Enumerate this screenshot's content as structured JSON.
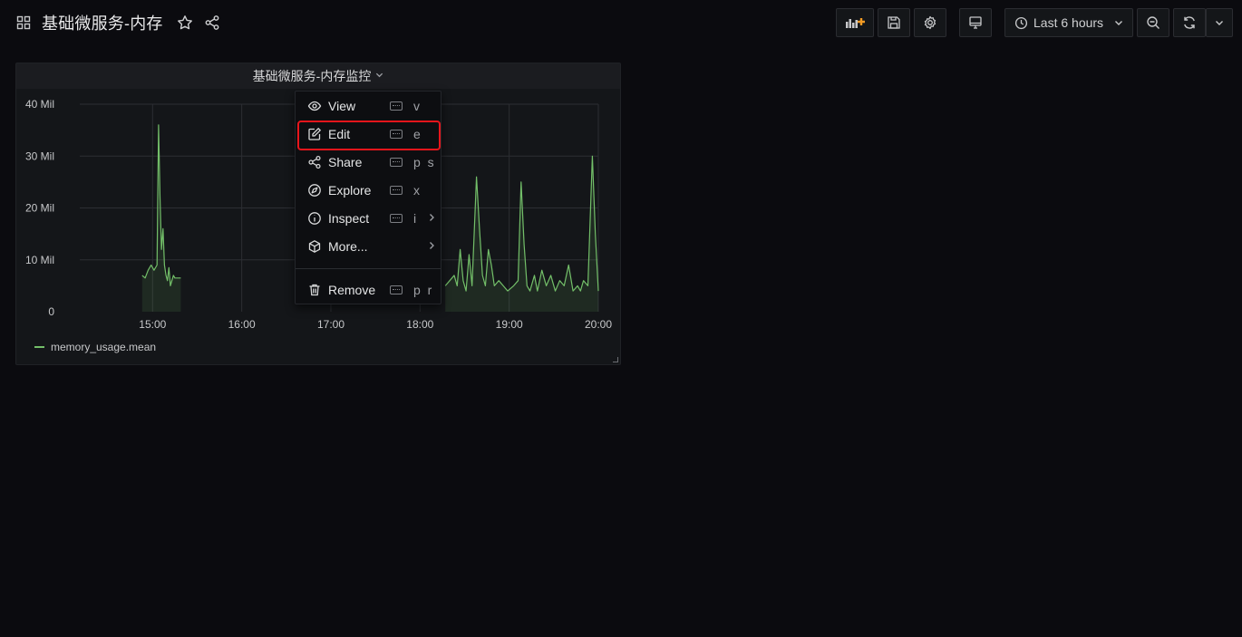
{
  "dashboard": {
    "title": "基础微服务-内存"
  },
  "toolbar": {
    "time_range_label": "Last 6 hours"
  },
  "panel": {
    "title": "基础微服务-内存监控",
    "legend_label": "memory_usage.mean",
    "series_color": "#73bf69"
  },
  "menu": {
    "items": [
      {
        "label": "View",
        "shortcut": "v",
        "icon": "eye-icon"
      },
      {
        "label": "Edit",
        "shortcut": "e",
        "icon": "edit-icon"
      },
      {
        "label": "Share",
        "shortcut": "p s",
        "icon": "share-icon"
      },
      {
        "label": "Explore",
        "shortcut": "x",
        "icon": "compass-icon"
      },
      {
        "label": "Inspect",
        "shortcut": "i",
        "icon": "info-icon"
      },
      {
        "label": "More...",
        "shortcut": "",
        "icon": "cube-icon"
      },
      {
        "label": "Remove",
        "shortcut": "p r",
        "icon": "trash-icon"
      }
    ]
  },
  "chart_data": {
    "type": "line",
    "y_ticks": [
      "0",
      "10 Mil",
      "20 Mil",
      "30 Mil",
      "40 Mil"
    ],
    "ylim": [
      0,
      40000000
    ],
    "x_ticks": [
      "15:00",
      "16:00",
      "17:00",
      "18:00",
      "19:00",
      "20:00"
    ],
    "xlim": [
      "14:11",
      "20:00"
    ],
    "grid": true,
    "legend_position": "bottom-left",
    "series": [
      {
        "name": "memory_usage.mean",
        "color": "#73bf69",
        "segments": [
          [
            [
              "14:53",
              7
            ],
            [
              "14:55",
              6.5
            ],
            [
              "14:57",
              8
            ],
            [
              "14:59",
              9
            ],
            [
              "15:01",
              8
            ],
            [
              "15:03",
              9
            ],
            [
              "15:04",
              36
            ],
            [
              "15:05",
              22
            ],
            [
              "15:06",
              12
            ],
            [
              "15:07",
              16
            ],
            [
              "15:08",
              9
            ],
            [
              "15:09",
              7
            ],
            [
              "15:10",
              6
            ],
            [
              "15:11",
              8.5
            ],
            [
              "15:12",
              5
            ],
            [
              "15:13",
              6
            ],
            [
              "15:14",
              7
            ],
            [
              "15:15",
              6.5
            ],
            [
              "15:17",
              6.5
            ],
            [
              "15:19",
              6.5
            ]
          ],
          [
            [
              "18:17",
              5
            ],
            [
              "18:20",
              6
            ],
            [
              "18:23",
              7
            ],
            [
              "18:25",
              5
            ],
            [
              "18:27",
              12
            ],
            [
              "18:29",
              6
            ],
            [
              "18:31",
              4
            ],
            [
              "18:33",
              11
            ],
            [
              "18:35",
              5
            ],
            [
              "18:38",
              26
            ],
            [
              "18:40",
              16
            ],
            [
              "18:42",
              7
            ],
            [
              "18:44",
              5
            ],
            [
              "18:46",
              12
            ],
            [
              "18:48",
              9
            ],
            [
              "18:50",
              5
            ],
            [
              "18:53",
              6
            ],
            [
              "18:56",
              5
            ],
            [
              "18:59",
              4
            ],
            [
              "19:03",
              5
            ],
            [
              "19:06",
              6
            ],
            [
              "19:08",
              25
            ],
            [
              "19:10",
              13
            ],
            [
              "19:12",
              5
            ],
            [
              "19:14",
              4
            ],
            [
              "19:17",
              7
            ],
            [
              "19:19",
              4
            ],
            [
              "19:22",
              8
            ],
            [
              "19:25",
              5
            ],
            [
              "19:28",
              7
            ],
            [
              "19:31",
              4
            ],
            [
              "19:34",
              6
            ],
            [
              "19:37",
              5
            ],
            [
              "19:40",
              9
            ],
            [
              "19:43",
              4
            ],
            [
              "19:46",
              5
            ],
            [
              "19:48",
              4
            ],
            [
              "19:50",
              6
            ],
            [
              "19:53",
              5
            ],
            [
              "19:56",
              30
            ],
            [
              "19:58",
              15
            ],
            [
              "20:00",
              4
            ]
          ]
        ]
      }
    ]
  }
}
